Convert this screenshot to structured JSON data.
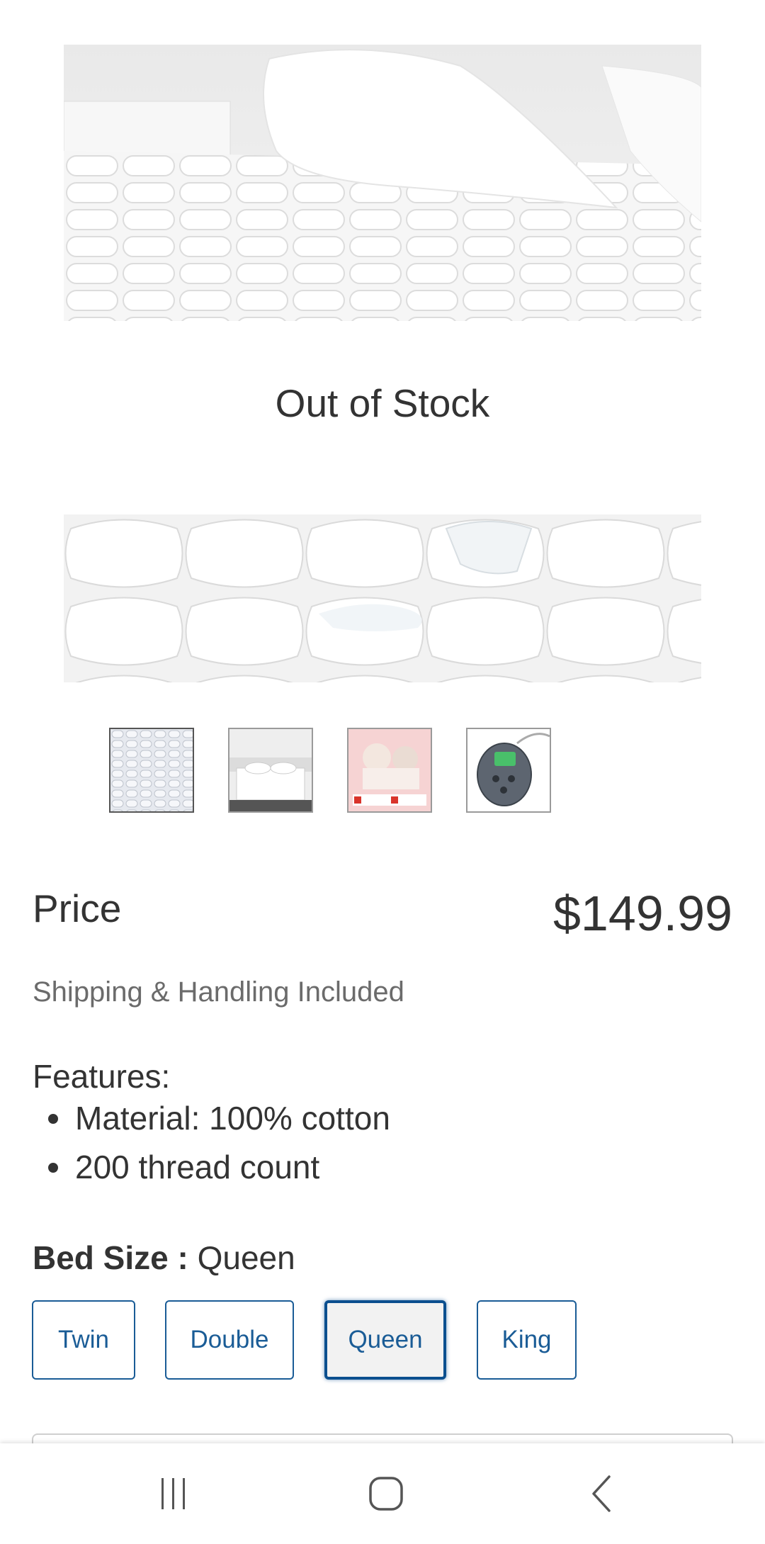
{
  "product_image": {
    "overlay_text": "Out of Stock"
  },
  "thumbnails": [
    {
      "name": "mattress-pad-thumb",
      "active": true
    },
    {
      "name": "bed-room-thumb",
      "active": false
    },
    {
      "name": "promo-thumb",
      "active": false
    },
    {
      "name": "controller-thumb",
      "active": false
    }
  ],
  "price": {
    "label": "Price",
    "value": "$149.99",
    "shipping_note": "Shipping & Handling Included"
  },
  "features": {
    "title": "Features:",
    "items": [
      "Material: 100% cotton",
      "200 thread count"
    ]
  },
  "bed_size": {
    "label": "Bed Size :",
    "selected": "Queen",
    "options": [
      "Twin",
      "Double",
      "Queen",
      "King"
    ]
  },
  "system_nav": {
    "recent_icon": "recent-apps-icon",
    "home_icon": "home-icon",
    "back_icon": "back-icon"
  },
  "colors": {
    "accent": "#1a5c96",
    "selected_border": "#0b4f8f",
    "text": "#333333",
    "muted": "#6b6b6b"
  }
}
